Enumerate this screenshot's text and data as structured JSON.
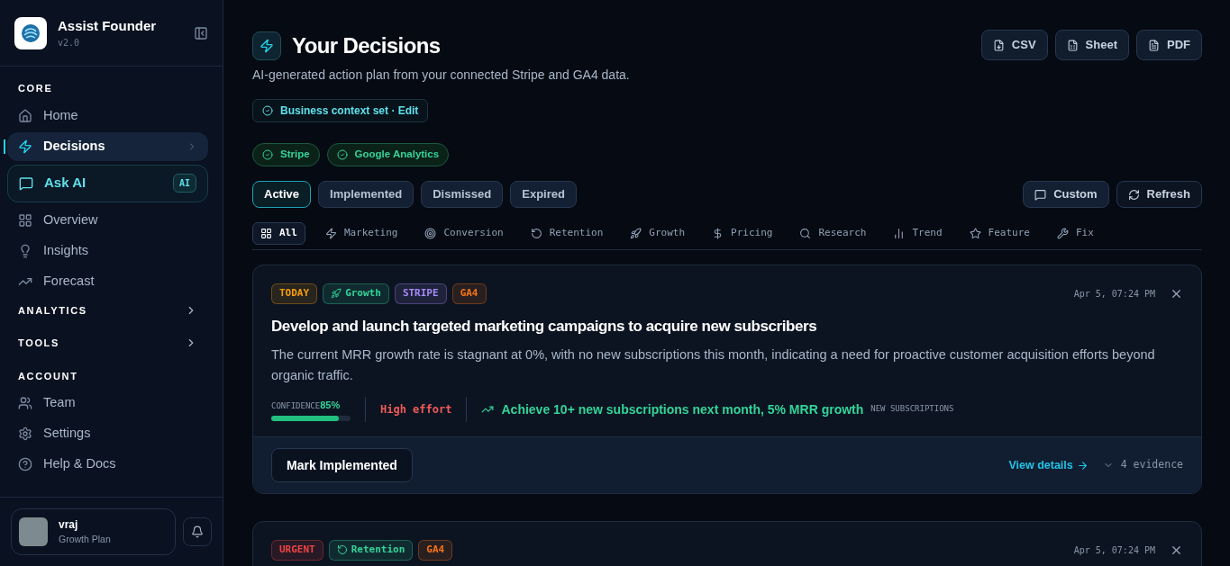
{
  "sidebar": {
    "app_name": "Assist Founder",
    "version": "v2.0",
    "sections": [
      {
        "title": "CORE",
        "expanded": true,
        "items": [
          {
            "label": "Home",
            "kind": "link",
            "selected": false
          },
          {
            "label": "Decisions",
            "kind": "link",
            "selected": true
          },
          {
            "label": "Ask AI",
            "kind": "ai",
            "badge": "AI",
            "selected": false
          },
          {
            "label": "Overview",
            "kind": "link",
            "selected": false
          },
          {
            "label": "Insights",
            "kind": "link",
            "selected": false
          },
          {
            "label": "Forecast",
            "kind": "link",
            "selected": false
          }
        ]
      },
      {
        "title": "ANALYTICS",
        "expanded": false
      },
      {
        "title": "TOOLS",
        "expanded": false
      },
      {
        "title": "ACCOUNT",
        "expanded": true,
        "items": [
          {
            "label": "Team",
            "kind": "link",
            "selected": false
          },
          {
            "label": "Settings",
            "kind": "link",
            "selected": false
          },
          {
            "label": "Help & Docs",
            "kind": "link",
            "selected": false
          }
        ]
      }
    ],
    "user": {
      "name": "vraj",
      "plan": "Growth Plan"
    }
  },
  "header": {
    "title": "Your Decisions",
    "subtitle": "AI-generated action plan from your connected Stripe and GA4 data.",
    "exports": [
      "CSV",
      "Sheet",
      "PDF"
    ],
    "context": "Business context set · Edit"
  },
  "connections": [
    "Stripe",
    "Google Analytics"
  ],
  "status_tabs": [
    {
      "label": "Active",
      "selected": true
    },
    {
      "label": "Implemented",
      "selected": false
    },
    {
      "label": "Dismissed",
      "selected": false
    },
    {
      "label": "Expired",
      "selected": false
    }
  ],
  "actions": [
    "Custom",
    "Refresh"
  ],
  "filters": [
    {
      "label": "All",
      "selected": true
    },
    {
      "label": "Marketing",
      "selected": false
    },
    {
      "label": "Conversion",
      "selected": false
    },
    {
      "label": "Retention",
      "selected": false
    },
    {
      "label": "Growth",
      "selected": false
    },
    {
      "label": "Pricing",
      "selected": false
    },
    {
      "label": "Research",
      "selected": false
    },
    {
      "label": "Trend",
      "selected": false
    },
    {
      "label": "Feature",
      "selected": false
    },
    {
      "label": "Fix",
      "selected": false
    }
  ],
  "cards": [
    {
      "tags": [
        {
          "label": "TODAY",
          "kind": "priority",
          "color": "#f59e0b"
        },
        {
          "label": "Growth",
          "kind": "growth",
          "color": "#34d399"
        },
        {
          "label": "STRIPE",
          "kind": "source",
          "color": "#a78bfa"
        },
        {
          "label": "GA4",
          "kind": "source",
          "color": "#f97316"
        }
      ],
      "time": "Apr 5, 07:24 PM",
      "title": "Develop and launch targeted marketing campaigns to acquire new subscribers",
      "body": "The current MRR growth rate is stagnant at 0%, with no new subscriptions this month, indicating a need for proactive customer acquisition efforts beyond organic traffic.",
      "confidence_label": "CONFIDENCE",
      "confidence": "85%",
      "level": 0.85,
      "effort": "High effort",
      "outcome": "Achieve 10+ new subscriptions next month, 5% MRR growth",
      "metric": "NEW SUBSCRIPTIONS",
      "footer": {
        "button": "Mark Implemented",
        "link": "View details",
        "evidence": "4 evidence"
      }
    },
    {
      "tags": [
        {
          "label": "URGENT",
          "kind": "priority",
          "color": "#ef4444"
        },
        {
          "label": "Retention",
          "kind": "retention",
          "color": "#34d399"
        },
        {
          "label": "GA4",
          "kind": "source",
          "color": "#f97316"
        }
      ],
      "time": "Apr 5, 07:24 PM"
    }
  ]
}
